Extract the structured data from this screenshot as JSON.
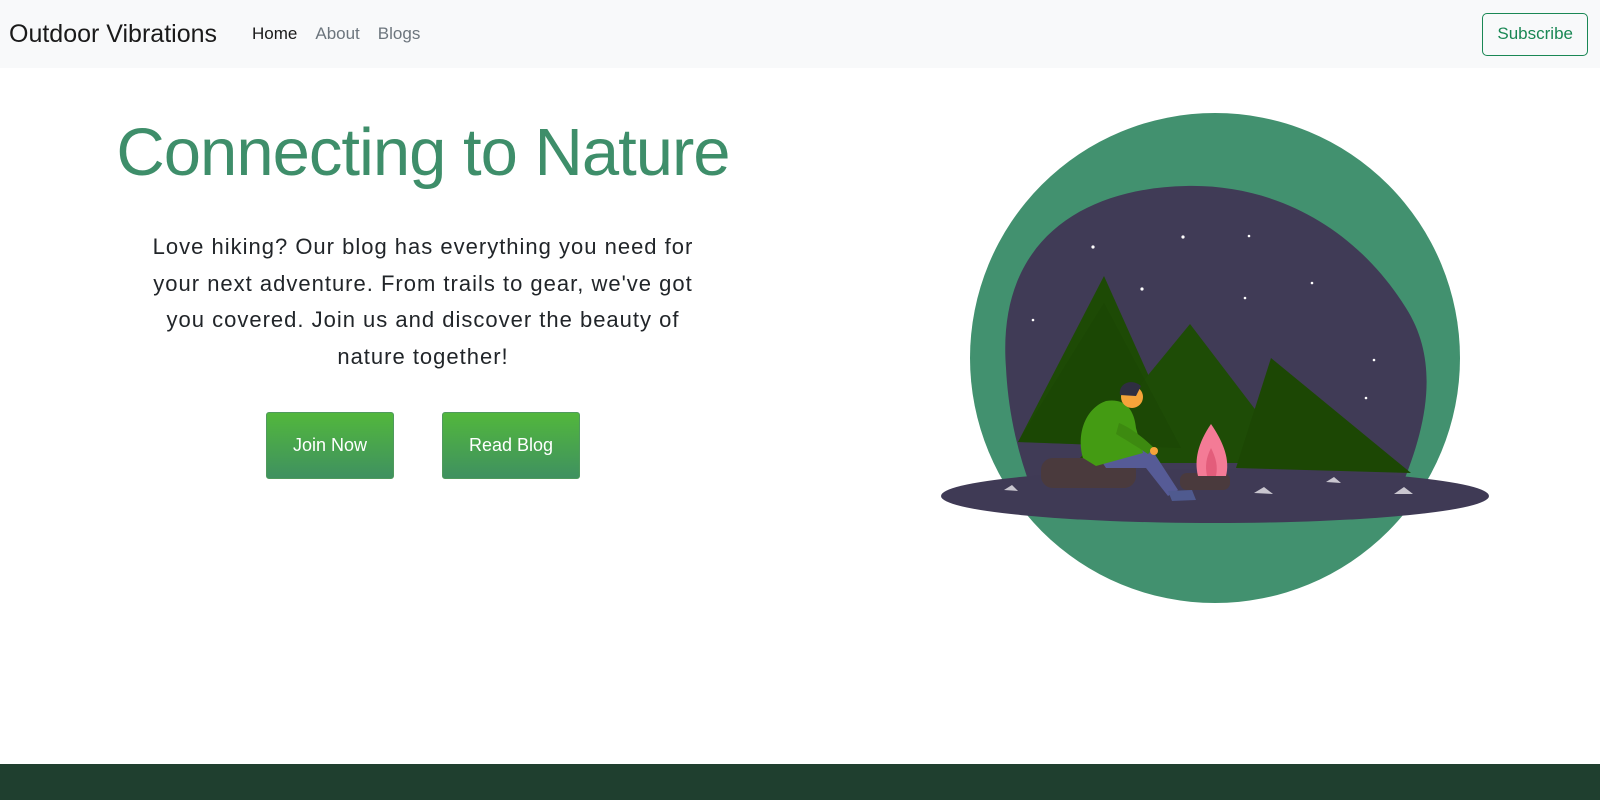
{
  "navbar": {
    "brand": "Outdoor Vibrations",
    "links": [
      {
        "label": "Home",
        "active": true
      },
      {
        "label": "About",
        "active": false
      },
      {
        "label": "Blogs",
        "active": false
      }
    ],
    "subscribe_label": "Subscribe"
  },
  "hero": {
    "title": "Connecting to Nature",
    "description": "Love hiking? Our blog has everything you need for your next adventure. From trails to gear, we've got you covered. Join us and discover the beauty of nature together!",
    "buttons": {
      "join_label": "Join Now",
      "read_label": "Read Blog"
    }
  },
  "illustration": {
    "subject": "camper-by-campfire-icon"
  },
  "colors": {
    "navbar_bg": "#f8f9fa",
    "accent_green": "#3e8e6a",
    "subscribe_outline": "#198754",
    "button_gradient_top": "#52b73c",
    "button_gradient_bottom": "#3f9160",
    "night_sky": "#3f3a55",
    "mountain": "#1e4a06",
    "campfire": "#f47b96",
    "footer_bg": "#1f3f2f"
  }
}
